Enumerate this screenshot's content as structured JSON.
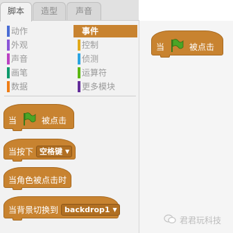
{
  "tabs": [
    {
      "label": "脚本",
      "active": true
    },
    {
      "label": "造型",
      "active": false
    },
    {
      "label": "声音",
      "active": false
    }
  ],
  "categories": [
    {
      "label": "动作",
      "color": "#4a6cd4"
    },
    {
      "label": "事件",
      "color": "#c88330",
      "selected": true
    },
    {
      "label": "外观",
      "color": "#8a55d7"
    },
    {
      "label": "控制",
      "color": "#e1a91a"
    },
    {
      "label": "声音",
      "color": "#bb42c3"
    },
    {
      "label": "侦测",
      "color": "#2ca5e2"
    },
    {
      "label": "画笔",
      "color": "#0e9a6c"
    },
    {
      "label": "运算符",
      "color": "#5cb712"
    },
    {
      "label": "数据",
      "color": "#ee7d16"
    },
    {
      "label": "更多模块",
      "color": "#632d99"
    }
  ],
  "palette_blocks": {
    "flag_clicked": {
      "pre": "当",
      "post": "被点击"
    },
    "key_pressed": {
      "pre": "当按下",
      "dropdown": "空格键"
    },
    "sprite_clicked": {
      "label": "当角色被点击时"
    },
    "backdrop_switch": {
      "pre": "当背景切换到",
      "dropdown": "backdrop1"
    }
  },
  "script_blocks": {
    "flag_clicked": {
      "pre": "当",
      "post": "被点击"
    }
  },
  "watermark": {
    "text": "君君玩科技",
    "icon": "wechat-icon"
  },
  "colors": {
    "events": "#c88330",
    "flag": "#4ca526"
  }
}
